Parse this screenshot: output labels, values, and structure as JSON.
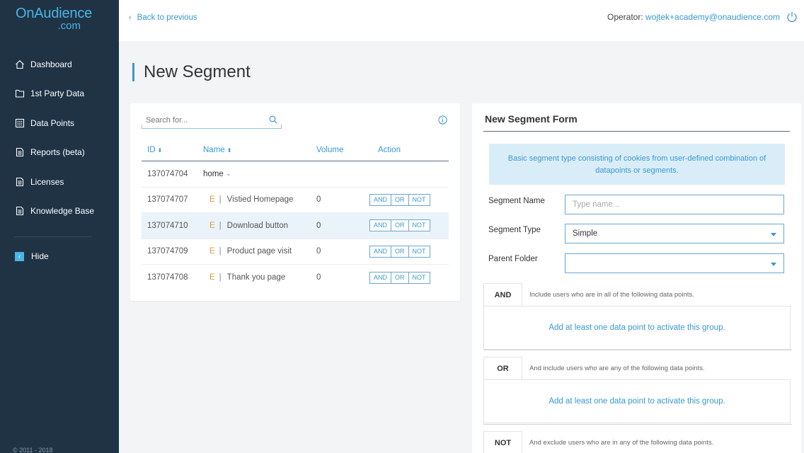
{
  "sidebar": {
    "logo_main": "OnAudience",
    "logo_sub": ".com",
    "items": [
      {
        "label": "Dashboard",
        "icon": "home-icon"
      },
      {
        "label": "1st Party Data",
        "icon": "folder-icon"
      },
      {
        "label": "Data Points",
        "icon": "grid-icon"
      },
      {
        "label": "Reports (beta)",
        "icon": "document-icon"
      },
      {
        "label": "Licenses",
        "icon": "document-icon"
      },
      {
        "label": "Knowledge Base",
        "icon": "document-icon"
      }
    ],
    "hide_label": "Hide",
    "copyright": "© 2011 - 2018"
  },
  "topbar": {
    "back_label": "Back to previous",
    "operator_label": "Operator:",
    "operator_email": "wojtek+academy@onaudience.com"
  },
  "page": {
    "title": "New Segment"
  },
  "search": {
    "placeholder": "Search for..."
  },
  "table": {
    "headers": {
      "id": "ID",
      "name": "Name",
      "volume": "Volume",
      "action": "Action"
    },
    "group_row": {
      "id": "137074704",
      "name": "home"
    },
    "rows": [
      {
        "id": "137074707",
        "type": "E",
        "name": "Vistied Homepage",
        "volume": "0"
      },
      {
        "id": "137074710",
        "type": "E",
        "name": "Download button",
        "volume": "0"
      },
      {
        "id": "137074709",
        "type": "E",
        "name": "Product page visit",
        "volume": "0"
      },
      {
        "id": "137074708",
        "type": "E",
        "name": "Thank you page",
        "volume": "0"
      }
    ],
    "actions": {
      "and": "AND",
      "or": "OR",
      "not": "NOT"
    },
    "separator": "|"
  },
  "form": {
    "title": "New Segment Form",
    "info": "Basic segment type consisting of cookies from user-defined combination of datapoints or segments.",
    "segment_name_label": "Segment Name",
    "segment_name_placeholder": "Type name...",
    "segment_type_label": "Segment Type",
    "segment_type_value": "Simple",
    "parent_folder_label": "Parent Folder",
    "parent_folder_value": "",
    "rules": [
      {
        "tag": "AND",
        "desc": "Include users who are in all of the following data points.",
        "body": "Add at least one data point to activate this group."
      },
      {
        "tag": "OR",
        "desc": "And include users who are any of the following data points.",
        "body": "Add at least one data point to activate this group."
      },
      {
        "tag": "NOT",
        "desc": "And exclude users who are in any of the following data points.",
        "body": ""
      }
    ]
  },
  "colors": {
    "sidebar_bg": "#1f3345",
    "accent": "#3a98cf",
    "info_bg": "#d9edf8",
    "event_mark": "#e59a3a"
  }
}
